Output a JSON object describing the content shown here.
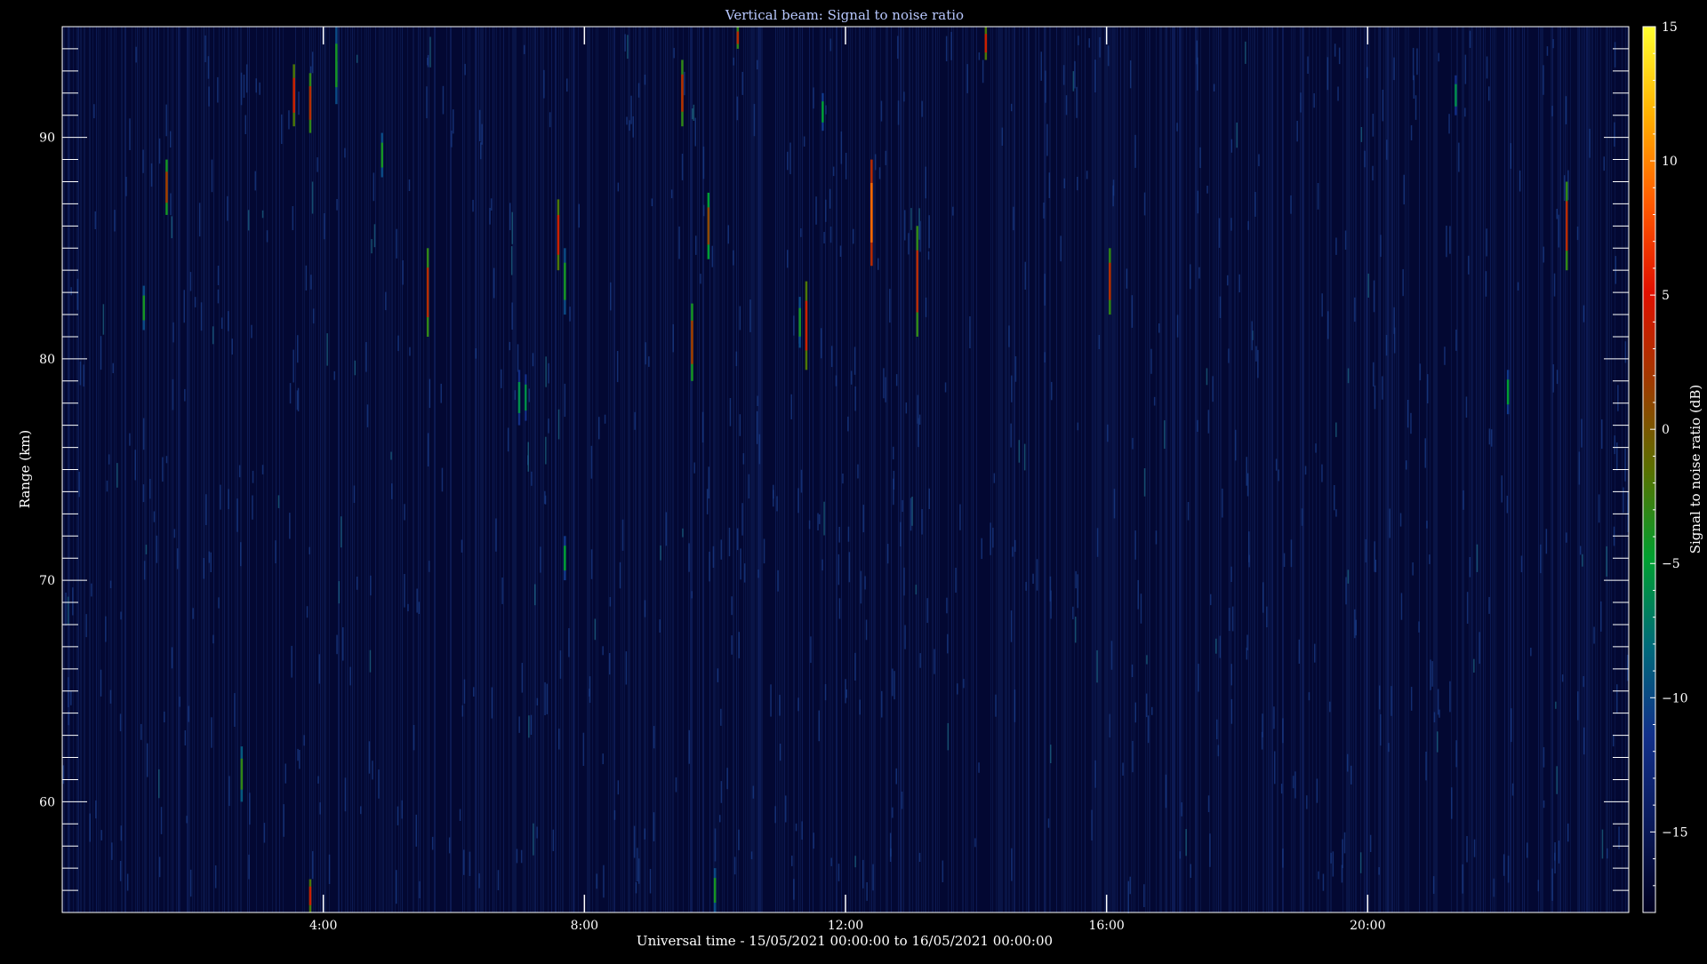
{
  "chart_data": {
    "type": "heatmap",
    "title": "Vertical beam: Signal to noise ratio",
    "xlabel": "Universal time - 15/05/2021 00:00:00 to 16/05/2021 00:00:00",
    "ylabel": "Range (km)",
    "colorbar_label": "Signal to noise ratio (dB)",
    "x_units": "hours UT",
    "xlim": [
      0,
      24
    ],
    "ylim": [
      55,
      95
    ],
    "x_major_ticks": [
      4,
      8,
      12,
      16,
      20
    ],
    "x_tick_labels": [
      "4:00",
      "8:00",
      "12:00",
      "16:00",
      "20:00"
    ],
    "y_major_ticks": [
      60,
      70,
      80,
      90
    ],
    "y_tick_labels": [
      "60",
      "70",
      "80",
      "90"
    ],
    "y_minor_step": 1,
    "colorbar_range": [
      -18,
      15
    ],
    "colorbar_ticks": [
      -15,
      -10,
      -5,
      0,
      5,
      10,
      15
    ],
    "colorbar_tick_labels": [
      "−15",
      "−10",
      "−5",
      "0",
      "5",
      "10",
      "15"
    ],
    "background_snr_db": -17,
    "colors": {
      "background": "#000000",
      "axes": "#ffffff",
      "title": "#b8c8ff",
      "colormap": [
        "#000020",
        "#0a1a5a",
        "#12308a",
        "#006a7a",
        "#00a030",
        "#5a7000",
        "#a03a00",
        "#e01000",
        "#ff5a00",
        "#ffb000",
        "#ffff30"
      ]
    },
    "events": [
      {
        "time": 1.25,
        "range_start": 81.3,
        "range_end": 83.3,
        "snr_peak": -4
      },
      {
        "time": 1.6,
        "range_start": 86.5,
        "range_end": 89.0,
        "snr_peak": 2
      },
      {
        "time": 2.75,
        "range_start": 60.0,
        "range_end": 62.5,
        "snr_peak": -3
      },
      {
        "time": 3.55,
        "range_start": 90.5,
        "range_end": 93.3,
        "snr_peak": 4
      },
      {
        "time": 3.8,
        "range_start": 90.2,
        "range_end": 92.9,
        "snr_peak": 3
      },
      {
        "time": 3.8,
        "range_start": 55.0,
        "range_end": 56.5,
        "snr_peak": 4
      },
      {
        "time": 4.2,
        "range_start": 91.5,
        "range_end": 95.0,
        "snr_peak": -4
      },
      {
        "time": 4.9,
        "range_start": 88.2,
        "range_end": 90.2,
        "snr_peak": -4
      },
      {
        "time": 5.6,
        "range_start": 81.0,
        "range_end": 85.0,
        "snr_peak": 3
      },
      {
        "time": 7.0,
        "range_start": 77.0,
        "range_end": 79.5,
        "snr_peak": -6
      },
      {
        "time": 7.1,
        "range_start": 77.2,
        "range_end": 79.3,
        "snr_peak": -6
      },
      {
        "time": 7.6,
        "range_start": 84.0,
        "range_end": 87.2,
        "snr_peak": 4
      },
      {
        "time": 7.7,
        "range_start": 82.0,
        "range_end": 85.0,
        "snr_peak": -4
      },
      {
        "time": 7.7,
        "range_start": 70.0,
        "range_end": 72.0,
        "snr_peak": -5
      },
      {
        "time": 9.5,
        "range_start": 90.5,
        "range_end": 93.5,
        "snr_peak": 3
      },
      {
        "time": 9.65,
        "range_start": 79.0,
        "range_end": 82.5,
        "snr_peak": 2
      },
      {
        "time": 9.9,
        "range_start": 84.5,
        "range_end": 87.5,
        "snr_peak": 1
      },
      {
        "time": 10.0,
        "range_start": 55.0,
        "range_end": 57.0,
        "snr_peak": -4
      },
      {
        "time": 10.35,
        "range_start": 94.0,
        "range_end": 95.0,
        "snr_peak": 3
      },
      {
        "time": 11.3,
        "range_start": 80.5,
        "range_end": 82.8,
        "snr_peak": -4
      },
      {
        "time": 11.4,
        "range_start": 79.5,
        "range_end": 83.5,
        "snr_peak": 4
      },
      {
        "time": 11.65,
        "range_start": 90.3,
        "range_end": 92.0,
        "snr_peak": -5
      },
      {
        "time": 12.4,
        "range_start": 84.2,
        "range_end": 89.0,
        "snr_peak": 9
      },
      {
        "time": 13.1,
        "range_start": 81.0,
        "range_end": 86.0,
        "snr_peak": 3
      },
      {
        "time": 14.15,
        "range_start": 93.5,
        "range_end": 95.0,
        "snr_peak": 4
      },
      {
        "time": 16.05,
        "range_start": 82.0,
        "range_end": 85.0,
        "snr_peak": 3
      },
      {
        "time": 21.35,
        "range_start": 91.0,
        "range_end": 92.8,
        "snr_peak": -6
      },
      {
        "time": 22.15,
        "range_start": 77.5,
        "range_end": 79.5,
        "snr_peak": -5
      },
      {
        "time": 23.05,
        "range_start": 84.0,
        "range_end": 88.0,
        "snr_peak": 3
      }
    ]
  }
}
